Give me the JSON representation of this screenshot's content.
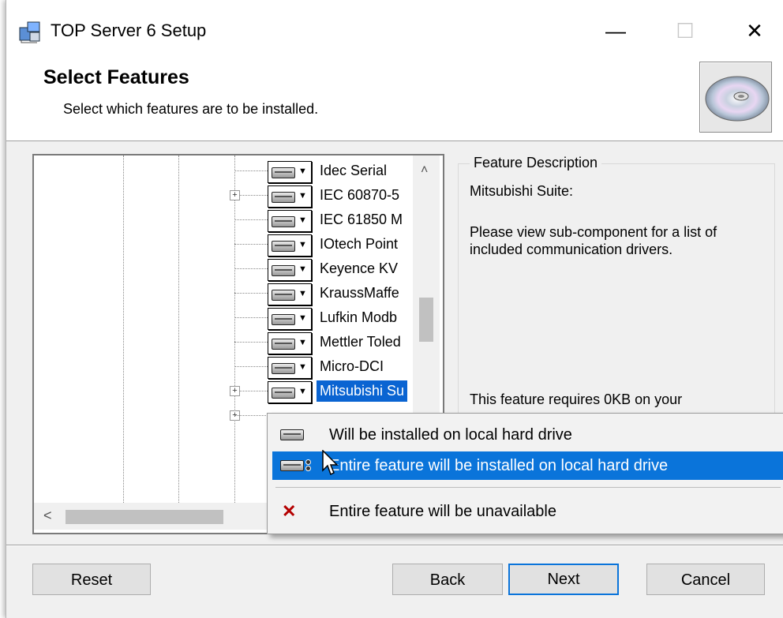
{
  "window": {
    "title": "TOP Server 6 Setup",
    "controls": {
      "minimize": "—",
      "maximize": "☐",
      "close": "✕"
    }
  },
  "header": {
    "title": "Select Features",
    "subtitle": "Select which features are to be installed."
  },
  "tree": {
    "items": [
      {
        "label": "Idec Serial",
        "expandable": false,
        "selected": false
      },
      {
        "label": "IEC 60870-5",
        "expandable": true,
        "selected": false
      },
      {
        "label": "IEC 61850 M",
        "expandable": false,
        "selected": false
      },
      {
        "label": "IOtech Point",
        "expandable": false,
        "selected": false
      },
      {
        "label": "Keyence KV",
        "expandable": false,
        "selected": false
      },
      {
        "label": "KraussMaffe",
        "expandable": false,
        "selected": false
      },
      {
        "label": "Lufkin Modb",
        "expandable": false,
        "selected": false
      },
      {
        "label": "Mettler Toled",
        "expandable": false,
        "selected": false
      },
      {
        "label": "Micro-DCI",
        "expandable": false,
        "selected": false
      },
      {
        "label": "Mitsubishi Su",
        "expandable": true,
        "selected": true
      }
    ],
    "expander_symbol": "+",
    "scroll_up": "˄",
    "scroll_left": "<"
  },
  "description": {
    "legend": "Feature Description",
    "name": "Mitsubishi Suite:",
    "text": "Please view sub-component for a list of included communication drivers.",
    "requirement": "This feature requires 0KB on your"
  },
  "context_menu": {
    "items": [
      {
        "label": "Will be installed on local hard drive",
        "icon": "hard-drive-icon",
        "highlighted": false
      },
      {
        "label": "Entire feature will be installed on local hard drive",
        "icon": "hard-drive-subfeatures-icon",
        "highlighted": true
      },
      {
        "label": "Entire feature will be unavailable",
        "icon": "red-x-icon",
        "highlighted": false
      }
    ],
    "x_symbol": "✕"
  },
  "buttons": {
    "reset": "Reset",
    "back": "Back",
    "next": "Next",
    "cancel": "Cancel"
  },
  "colors": {
    "selection": "#0a64d2",
    "menu_highlight": "#0a74da",
    "unavailable_x": "#b40000"
  }
}
